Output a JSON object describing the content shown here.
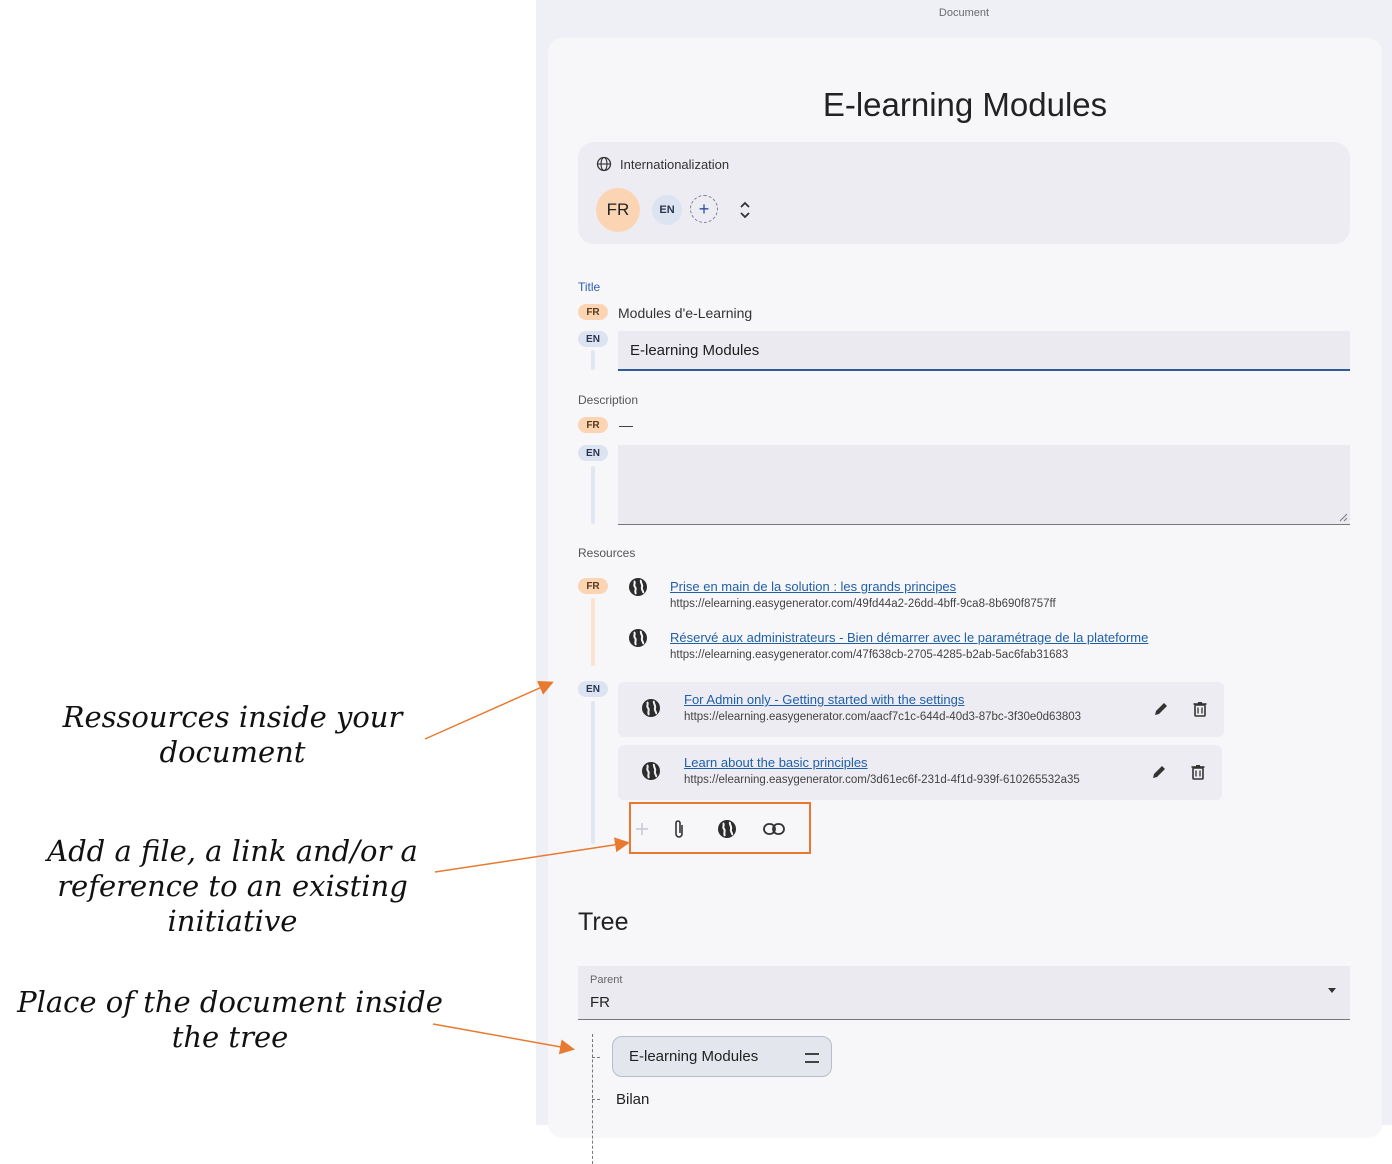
{
  "annotations": {
    "resources": [
      "Ressources inside your",
      "document"
    ],
    "add": [
      "Add a file, a link and/or a",
      "reference to an existing",
      "initiative"
    ],
    "tree": [
      "Place of the document inside",
      "the tree"
    ],
    "arrow_color": "#e8792f"
  },
  "app": {
    "header": "Document",
    "doc_title": "E-learning Modules",
    "intl": {
      "label": "Internationalization",
      "icon": "globe-icon",
      "primary_lang": "FR",
      "secondary_lang": "EN",
      "add_symbol": "+"
    },
    "title_section": {
      "label": "Title",
      "fr_chip": "FR",
      "fr_value": "Modules d'e-Learning",
      "en_chip": "EN",
      "en_value": "E-learning Modules"
    },
    "description_section": {
      "label": "Description",
      "fr_chip": "FR",
      "fr_value": "—",
      "en_chip": "EN",
      "en_value": ""
    },
    "resources": {
      "label": "Resources",
      "fr_chip": "FR",
      "en_chip": "EN",
      "fr_items": [
        {
          "title": "Prise en main de la solution : les grands principes",
          "url": "https://elearning.easygenerator.com/49fd44a2-26dd-4bff-9ca8-8b690f8757ff"
        },
        {
          "title": "Réservé aux administrateurs - Bien démarrer avec le paramétrage de la plateforme",
          "url": "https://elearning.easygenerator.com/47f638cb-2705-4285-b2ab-5ac6fab31683"
        }
      ],
      "en_items": [
        {
          "title": "For Admin only - Getting started with the settings",
          "url": "https://elearning.easygenerator.com/aacf7c1c-644d-40d3-87bc-3f30e0d63803"
        },
        {
          "title": "Learn about the basic principles",
          "url": "https://elearning.easygenerator.com/3d61ec6f-231d-4f1d-939f-610265532a35"
        }
      ],
      "toolbar": [
        "add-icon",
        "paperclip-icon",
        "globe-icon",
        "link-icon"
      ]
    },
    "tree": {
      "title": "Tree",
      "parent_label": "Parent",
      "parent_value": "FR",
      "current_node": "E-learning Modules",
      "sibling": "Bilan"
    },
    "colors": {
      "fr_chip": "#fbd5b3",
      "en_chip": "#dce3f1",
      "link": "#1f5fa8",
      "highlight": "#e8792f"
    }
  }
}
